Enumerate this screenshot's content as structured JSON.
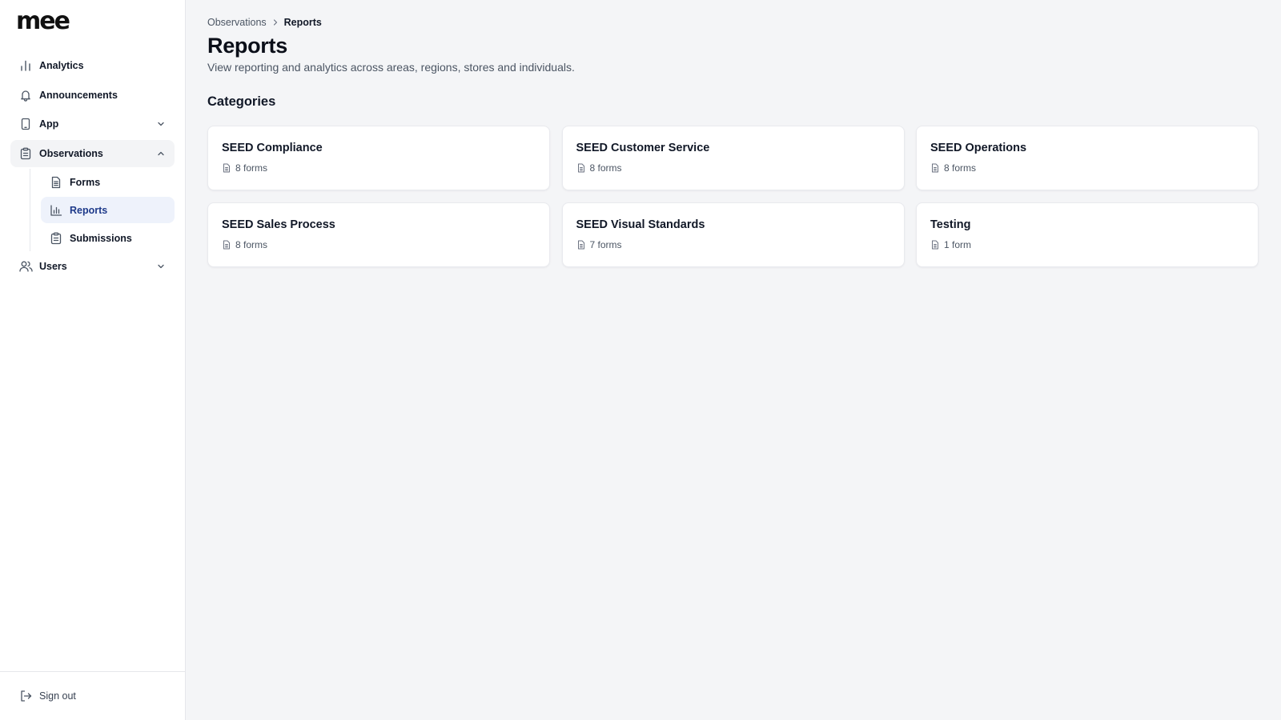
{
  "brand": {
    "logo_text": "mee"
  },
  "sidebar": {
    "items": [
      {
        "label": "Analytics",
        "icon": "bar-chart-icon"
      },
      {
        "label": "Announcements",
        "icon": "bell-icon"
      },
      {
        "label": "App",
        "icon": "phone-icon",
        "expanded": false
      },
      {
        "label": "Observations",
        "icon": "clipboard-icon",
        "expanded": true
      },
      {
        "label": "Users",
        "icon": "users-icon",
        "expanded": false
      }
    ],
    "observations_children": [
      {
        "label": "Forms",
        "icon": "document-icon"
      },
      {
        "label": "Reports",
        "icon": "bar-chart-icon",
        "active": true
      },
      {
        "label": "Submissions",
        "icon": "clipboard-icon"
      }
    ],
    "footer": {
      "sign_out_label": "Sign out",
      "icon": "sign-out-icon"
    }
  },
  "breadcrumb": {
    "parent": "Observations",
    "current": "Reports"
  },
  "page": {
    "title": "Reports",
    "subtitle": "View reporting and analytics across areas, regions, stores and individuals.",
    "section_title": "Categories"
  },
  "categories": [
    {
      "title": "SEED Compliance",
      "count_text": "8 forms"
    },
    {
      "title": "SEED Customer Service",
      "count_text": "8 forms"
    },
    {
      "title": "SEED Operations",
      "count_text": "8 forms"
    },
    {
      "title": "SEED Sales Process",
      "count_text": "8 forms"
    },
    {
      "title": "SEED Visual Standards",
      "count_text": "7 forms"
    },
    {
      "title": "Testing",
      "count_text": "1 form"
    }
  ],
  "colors": {
    "background": "#f4f5f7",
    "sidebar_bg": "#ffffff",
    "active_item_bg": "#eef2fb",
    "active_item_text": "#1e3a8a",
    "text_primary": "#111827",
    "text_secondary": "#4b5563"
  }
}
